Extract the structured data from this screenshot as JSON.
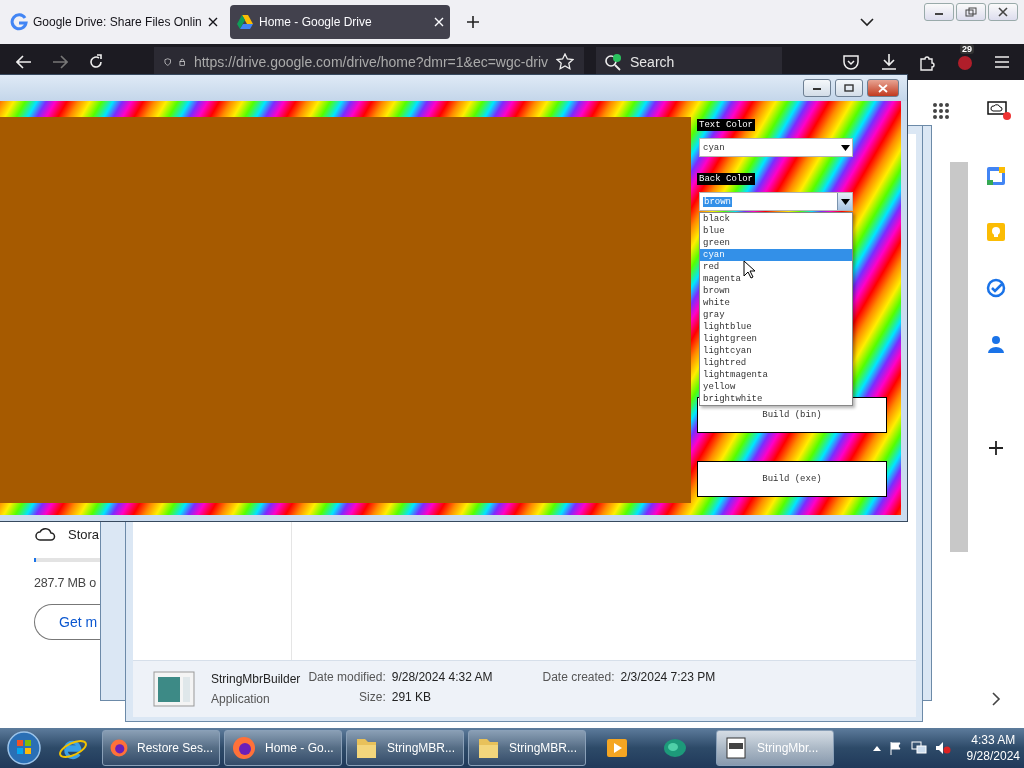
{
  "browser": {
    "tabs": [
      {
        "title": "Google Drive: Share Files Onlin",
        "selected": false
      },
      {
        "title": "Home - Google Drive",
        "selected": true
      }
    ],
    "address": "https://drive.google.com/drive/home?dmr=1&ec=wgc-driv",
    "search": {
      "placeholder": "Search"
    },
    "extensions_badge": "29"
  },
  "drive": {
    "storage_label": "Stora",
    "storage_used": "287.7 MB o",
    "storage_bar": {
      "level": 0.02
    },
    "get_more_button": "Get m"
  },
  "explorer_details": {
    "name": "StringMbrBuilder",
    "type": "Application",
    "fields": [
      {
        "label": "Date modified:",
        "value": "9/28/2024 4:32 AM"
      },
      {
        "label": "Size:",
        "value": "291 KB"
      },
      {
        "label": "Date created:",
        "value": "2/3/2024 7:23 PM"
      }
    ]
  },
  "app_window": {
    "text_color": {
      "label": "Text Color",
      "value": "cyan"
    },
    "back_color": {
      "label": "Back Color",
      "value": "brown",
      "expanded": true,
      "options": [
        {
          "label": "black",
          "highlighted": false
        },
        {
          "label": "blue",
          "highlighted": false
        },
        {
          "label": "green",
          "highlighted": false
        },
        {
          "label": "cyan",
          "highlighted": true
        },
        {
          "label": "red",
          "highlighted": false
        },
        {
          "label": "magenta",
          "highlighted": false
        },
        {
          "label": "brown",
          "highlighted": false
        },
        {
          "label": "white",
          "highlighted": false
        },
        {
          "label": "gray",
          "highlighted": false
        },
        {
          "label": "lightblue",
          "highlighted": false
        },
        {
          "label": "lightgreen",
          "highlighted": false
        },
        {
          "label": "lightcyan",
          "highlighted": false
        },
        {
          "label": "lightred",
          "highlighted": false
        },
        {
          "label": "lightmagenta",
          "highlighted": false
        },
        {
          "label": "yellow",
          "highlighted": false
        },
        {
          "label": "brightwhite",
          "highlighted": false
        }
      ]
    },
    "buttons": [
      "Build (bin)",
      "Build (exe)"
    ]
  },
  "taskbar": {
    "items": [
      {
        "kind": "button",
        "label": "Restore Ses...",
        "selected": false
      },
      {
        "kind": "button",
        "label": "Home - Go...",
        "selected": false
      },
      {
        "kind": "button",
        "label": "StringMBR...",
        "selected": false
      },
      {
        "kind": "button",
        "label": "StringMBR...",
        "selected": false
      },
      {
        "kind": "icon"
      },
      {
        "kind": "icon"
      },
      {
        "kind": "button",
        "label": "StringMbr...",
        "selected": true
      }
    ],
    "time": "4:33 AM",
    "date": "9/28/2024"
  }
}
